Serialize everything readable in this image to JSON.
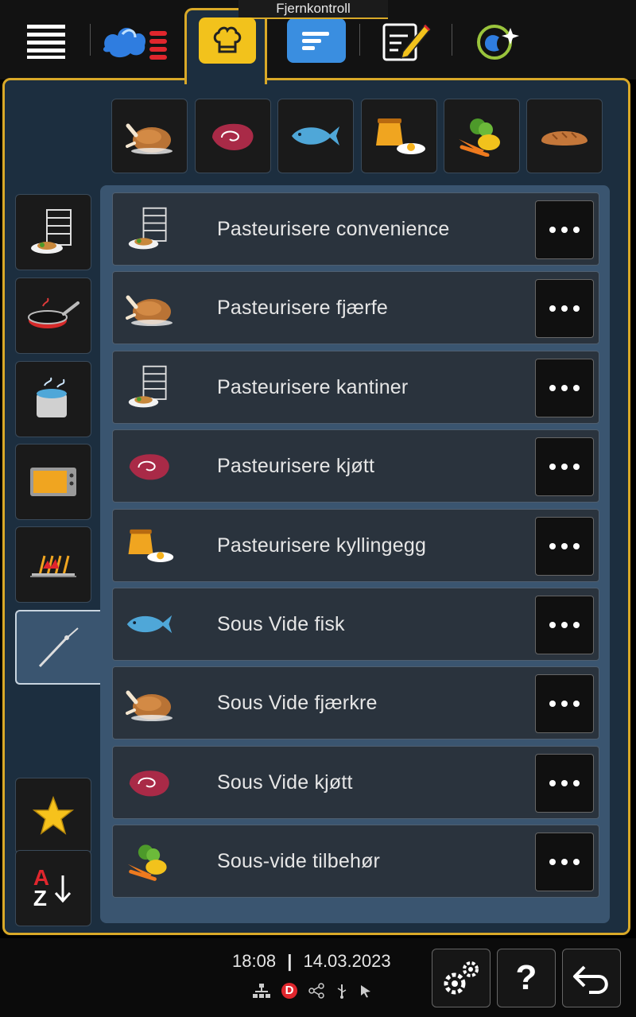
{
  "top_bar": {
    "remote_label": "Fjernkontroll",
    "buttons": [
      {
        "icon": "menu-icon"
      },
      {
        "icon": "cooking-modes-icon"
      },
      {
        "icon": "chef-hat-icon",
        "active": true
      },
      {
        "icon": "program-list-icon"
      },
      {
        "icon": "edit-icon"
      },
      {
        "icon": "connected-cooking-icon"
      }
    ]
  },
  "categories": [
    {
      "icon": "poultry-icon"
    },
    {
      "icon": "meat-icon"
    },
    {
      "icon": "fish-icon"
    },
    {
      "icon": "egg-dessert-icon"
    },
    {
      "icon": "vegetables-icon"
    },
    {
      "icon": "bread-icon"
    }
  ],
  "side_filters": [
    {
      "icon": "rack-plate-icon"
    },
    {
      "icon": "pan-icon"
    },
    {
      "icon": "pot-icon"
    },
    {
      "icon": "oven-icon"
    },
    {
      "icon": "grill-icon"
    },
    {
      "icon": "core-probe-icon",
      "active": true
    }
  ],
  "list": {
    "items": [
      {
        "label": "Pasteurisere convenience",
        "icon": "rack-plate-icon"
      },
      {
        "label": "Pasteurisere fjærfe",
        "icon": "poultry-icon"
      },
      {
        "label": "Pasteurisere kantiner",
        "icon": "rack-plate-icon"
      },
      {
        "label": "Pasteurisere kjøtt",
        "icon": "meat-icon"
      },
      {
        "label": "Pasteurisere kyllingegg",
        "icon": "egg-dessert-icon"
      },
      {
        "label": "Sous Vide fisk",
        "icon": "fish-icon"
      },
      {
        "label": "Sous Vide fjærkre",
        "icon": "poultry-icon"
      },
      {
        "label": "Sous Vide kjøtt",
        "icon": "meat-icon"
      },
      {
        "label": "Sous-vide tilbehør",
        "icon": "vegetables-icon"
      }
    ]
  },
  "sort": {
    "favorite_icon": "star-icon",
    "az_letters": {
      "a": "A",
      "z": "Z"
    }
  },
  "status": {
    "time": "18:08",
    "separator": "|",
    "date": "14.03.2023",
    "dealer_badge": "D"
  },
  "colors": {
    "accent": "#d9a928",
    "panel": "#1c2e3f",
    "list_bg": "#3a5570",
    "row_bg": "#2a333d"
  }
}
